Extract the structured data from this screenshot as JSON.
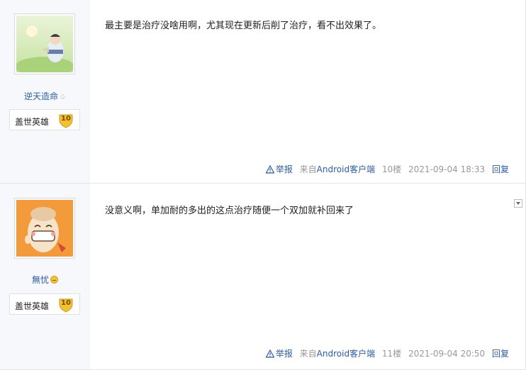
{
  "posts": [
    {
      "username": "逆天造命",
      "user_mark": "♤",
      "rank_title": "盖世英雄",
      "rank_level": "10",
      "content": "最主要是治疗没啥用啊，尤其现在更新后削了治疗，看不出效果了。",
      "report": "举报",
      "client_prefix": "来自",
      "client_link": "Android客户端",
      "floor": "10楼",
      "time": "2021-09-04 18:33",
      "reply": "回复"
    },
    {
      "username": "無忧",
      "user_mark_icon": "smile-emoji-icon",
      "rank_title": "盖世英雄",
      "rank_level": "10",
      "content": "没意义啊，单加耐的多出的这点治疗随便一个双加就补回来了",
      "report": "举报",
      "client_prefix": "来自",
      "client_link": "Android客户端",
      "floor": "11楼",
      "time": "2021-09-04 20:50",
      "reply": "回复"
    }
  ],
  "colors": {
    "link": "#2b5ca8",
    "sidebar_bg": "#f6f8fb",
    "badge_gold": "#f2c230"
  }
}
